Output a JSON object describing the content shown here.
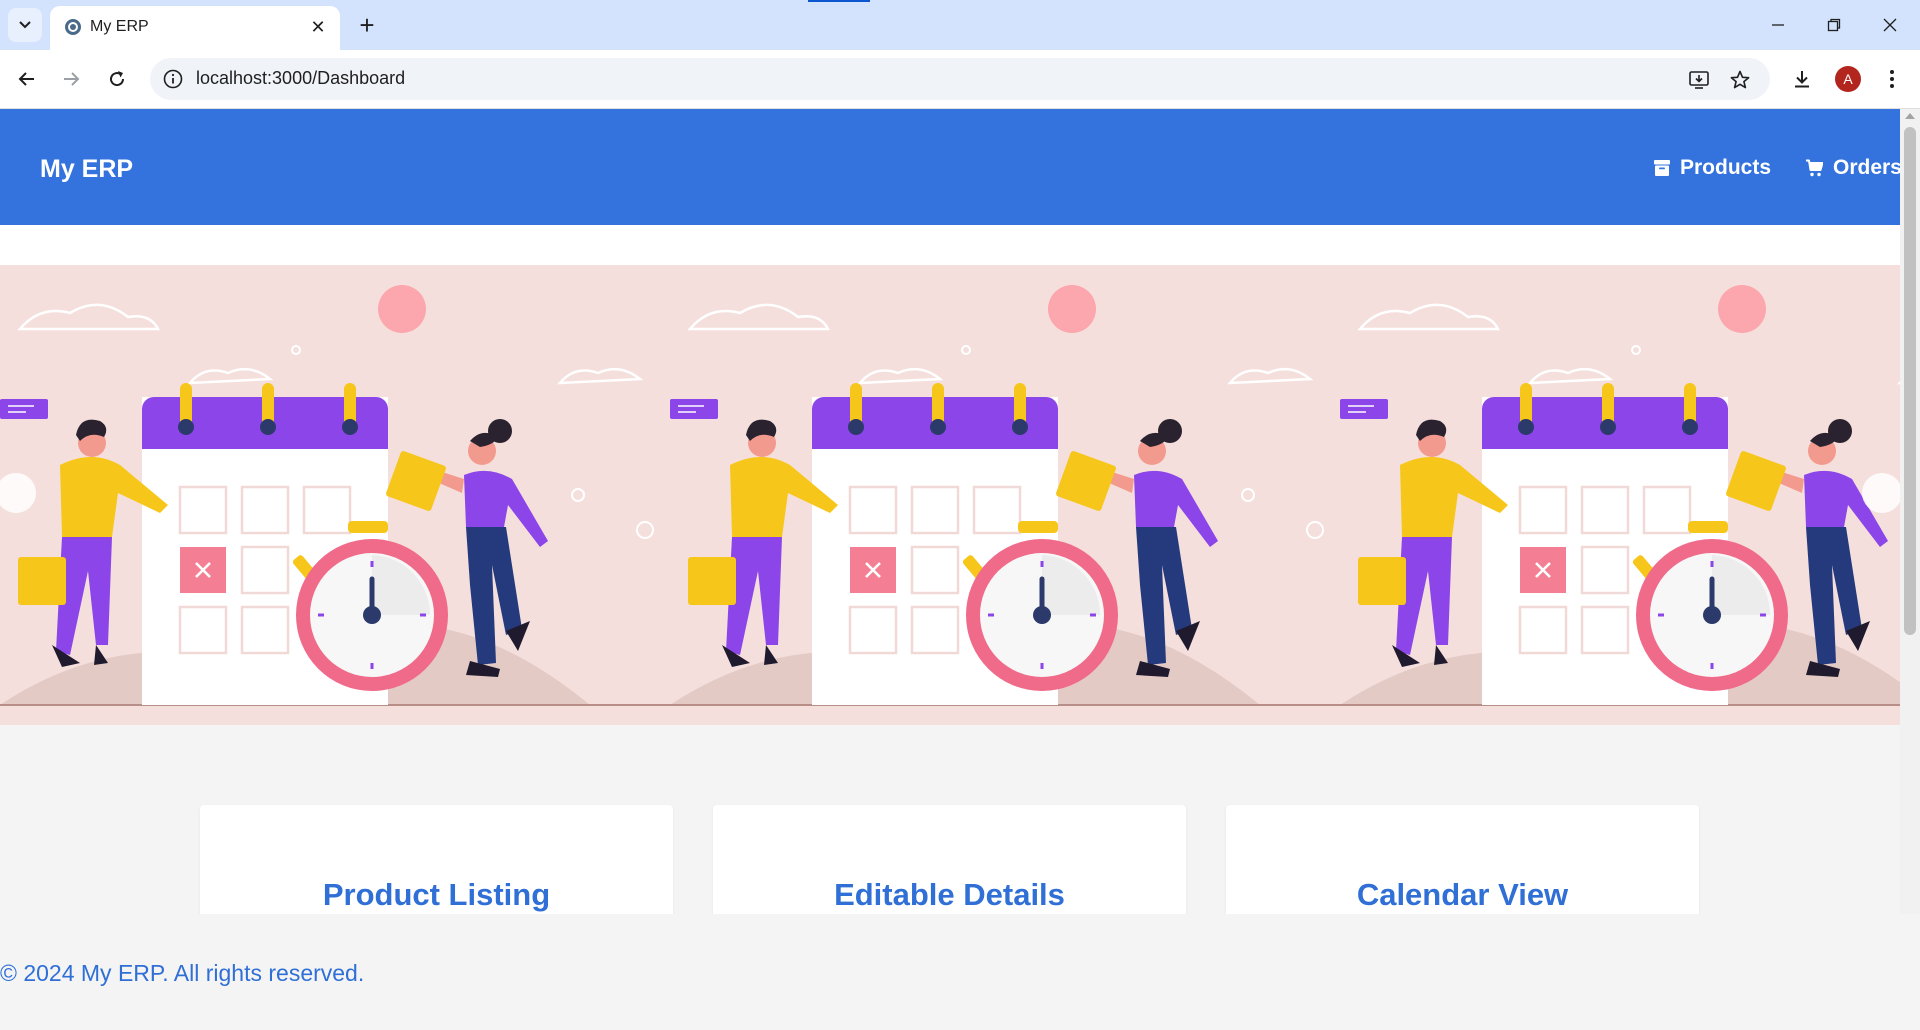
{
  "browser": {
    "tab_title": "My ERP",
    "url": "localhost:3000/Dashboard",
    "profile_initial": "A"
  },
  "app": {
    "brand": "My ERP",
    "nav": [
      {
        "label": "Products",
        "icon": "archive-box-icon"
      },
      {
        "label": "Orders",
        "icon": "shopping-cart-icon"
      }
    ],
    "colors": {
      "header": "#3473dd",
      "accent": "#2f6fd6",
      "carousel_bg": "#f5dfdc"
    }
  },
  "features": [
    {
      "title": "Product Listing"
    },
    {
      "title": "Editable Details"
    },
    {
      "title": "Calendar View"
    }
  ],
  "footer": {
    "text": "© 2024 My ERP. All rights reserved."
  }
}
